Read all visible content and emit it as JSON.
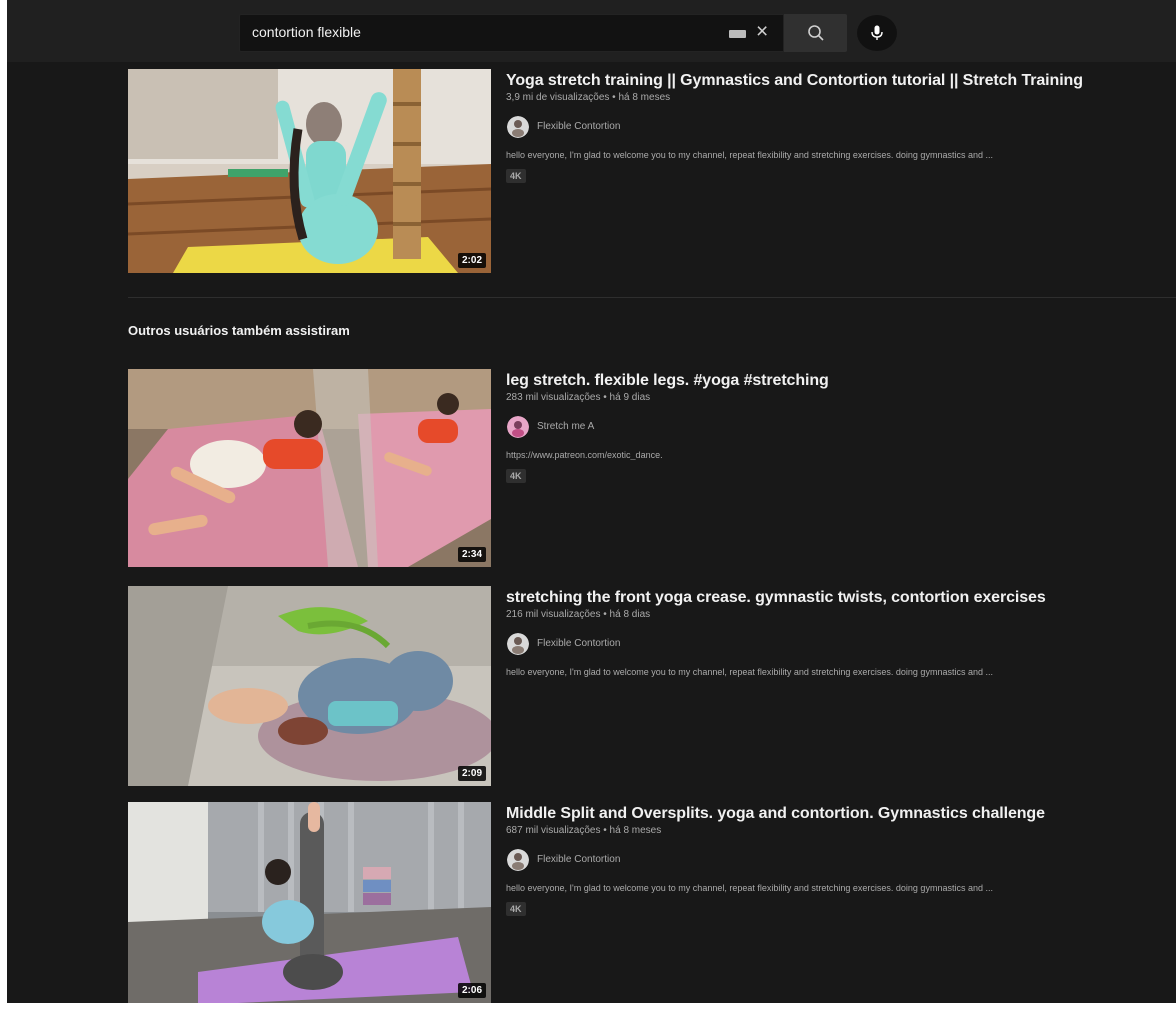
{
  "search": {
    "query": "contortion flexible",
    "clear_icon": "×"
  },
  "section_heading": "Outros usuários também assistiram",
  "videos": [
    {
      "title": "Yoga stretch training || Gymnastics and Contortion tutorial || Stretch Training",
      "meta": "3,9 mi de visualizações • há 8 meses",
      "channel": "Flexible Contortion",
      "description": "hello everyone, I'm glad to welcome you to my channel, repeat flexibility and stretching exercises. doing gymnastics and ...",
      "badge": "4K",
      "duration": "2:02"
    },
    {
      "title": "leg stretch. flexible legs. #yoga #stretching",
      "meta": "283 mil visualizações • há 9 dias",
      "channel": "Stretch me A",
      "description": "https://www.patreon.com/exotic_dance.",
      "badge": "4K",
      "duration": "2:34"
    },
    {
      "title": "stretching the front yoga crease. gymnastic twists, contortion exercises",
      "meta": "216 mil visualizações • há 8 dias",
      "channel": "Flexible Contortion",
      "description": "hello everyone, I'm glad to welcome you to my channel, repeat flexibility and stretching exercises. doing gymnastics and ...",
      "badge": "",
      "duration": "2:09"
    },
    {
      "title": "Middle Split and Oversplits. yoga and contortion. Gymnastics challenge",
      "meta": "687 mil visualizações • há 8 meses",
      "channel": "Flexible Contortion",
      "description": "hello everyone, I'm glad to welcome you to my channel, repeat flexibility and stretching exercises. doing gymnastics and ...",
      "badge": "4K",
      "duration": "2:06"
    }
  ],
  "icons": {
    "keyboard": "keyboard-icon",
    "clear": "close-icon",
    "search": "search-icon",
    "mic": "microphone-icon"
  },
  "colors": {
    "background": "#181818",
    "topbar": "#202020",
    "text_primary": "#f1f1f1",
    "text_secondary": "#aaaaaa"
  }
}
